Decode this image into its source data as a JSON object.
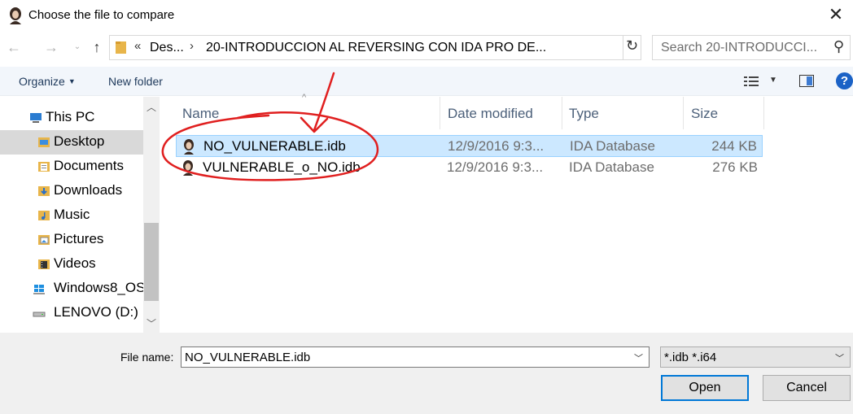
{
  "window": {
    "title": "Choose the file to compare",
    "close_glyph": "✕"
  },
  "address": {
    "overflow": "«",
    "segments": [
      "Des...",
      "20-INTRODUCCION AL REVERSING CON IDA PRO DE..."
    ],
    "separator": "›"
  },
  "search": {
    "placeholder": "Search 20-INTRODUCCI..."
  },
  "toolbar": {
    "organize_label": "Organize",
    "new_folder_label": "New folder",
    "help_glyph": "?"
  },
  "sidebar": {
    "items": [
      {
        "label": "This PC",
        "icon": "computer-icon"
      },
      {
        "label": "Desktop",
        "icon": "desktop-folder-icon",
        "selected": true
      },
      {
        "label": "Documents",
        "icon": "documents-folder-icon"
      },
      {
        "label": "Downloads",
        "icon": "downloads-folder-icon"
      },
      {
        "label": "Music",
        "icon": "music-folder-icon"
      },
      {
        "label": "Pictures",
        "icon": "pictures-folder-icon"
      },
      {
        "label": "Videos",
        "icon": "videos-folder-icon"
      },
      {
        "label": "Windows8_OS",
        "icon": "windows-drive-icon"
      },
      {
        "label": "LENOVO (D:)",
        "icon": "drive-icon"
      }
    ]
  },
  "filelist": {
    "columns": [
      "Name",
      "Date modified",
      "Type",
      "Size"
    ],
    "rows": [
      {
        "name": "NO_VULNERABLE.idb",
        "date": "12/9/2016 9:3...",
        "type": "IDA Database",
        "size": "244 KB",
        "selected": true
      },
      {
        "name": "VULNERABLE_o_NO.idb",
        "date": "12/9/2016 9:3...",
        "type": "IDA Database",
        "size": "276 KB",
        "selected": false
      }
    ]
  },
  "footer": {
    "file_name_label": "File name:",
    "file_name_value": "NO_VULNERABLE.idb",
    "file_type_value": "*.idb *.i64",
    "open_label": "Open",
    "cancel_label": "Cancel"
  },
  "colors": {
    "accent": "#0078d7",
    "selection": "#cce8ff",
    "annotation": "#e01f1f"
  }
}
